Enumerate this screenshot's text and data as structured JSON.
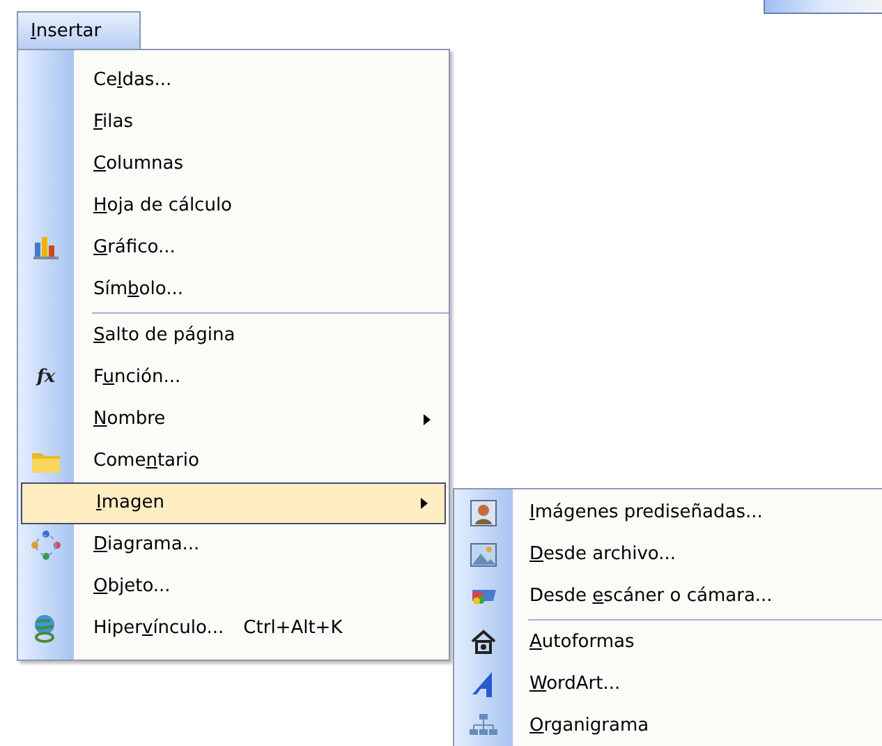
{
  "menu_bar": {
    "menu_title": {
      "key": "I",
      "after": "nsertar"
    },
    "open": true
  },
  "menu": {
    "items": [
      {
        "kind": "item",
        "label": {
          "before": "Ce",
          "key": "l",
          "after": "das..."
        },
        "selected": false
      },
      {
        "kind": "item",
        "label": {
          "key": "F",
          "after": "ilas"
        },
        "selected": false
      },
      {
        "kind": "item",
        "label": {
          "key": "C",
          "after": "olumnas"
        },
        "selected": false
      },
      {
        "kind": "item",
        "label": {
          "key": "H",
          "after": "oja de cálculo"
        },
        "selected": false
      },
      {
        "kind": "item",
        "label": {
          "key": "G",
          "after": "ráfico..."
        },
        "selected": false
      },
      {
        "kind": "item",
        "label": {
          "before": "Sím",
          "key": "b",
          "after": "olo..."
        },
        "selected": false
      },
      {
        "kind": "separator"
      },
      {
        "kind": "item",
        "label": {
          "key": "S",
          "after": "alto de página"
        },
        "selected": false
      },
      {
        "kind": "item",
        "label": {
          "before": "F",
          "key": "u",
          "after": "nción..."
        },
        "icon_glyph": "fx",
        "selected": false
      },
      {
        "kind": "item",
        "label": {
          "key": "N",
          "after": "ombre"
        },
        "selected": false,
        "has_submenu": true
      },
      {
        "kind": "item",
        "label": {
          "before": "Come",
          "key": "n",
          "after": "tario"
        },
        "selected": false
      },
      {
        "kind": "item",
        "label": {
          "key": "I",
          "after": "magen"
        },
        "selected": true,
        "has_submenu": true
      },
      {
        "kind": "item",
        "label": {
          "key": "D",
          "after": "iagrama..."
        },
        "selected": false
      },
      {
        "kind": "item",
        "label": {
          "key": "O",
          "after": "bjeto..."
        },
        "selected": false
      },
      {
        "kind": "item",
        "label": {
          "before": "Hiper",
          "key": "v",
          "after": "ínculo..."
        },
        "shortcut": "Ctrl+Alt+K",
        "selected": false
      }
    ]
  },
  "submenu": {
    "items": [
      {
        "kind": "item",
        "label": {
          "key": "I",
          "after": "mágenes prediseñadas..."
        },
        "selected": false
      },
      {
        "kind": "item",
        "label": {
          "key": "D",
          "after": "esde archivo..."
        },
        "selected": false
      },
      {
        "kind": "item",
        "label": {
          "before": "Desde ",
          "key": "e",
          "after": "scáner o cámara..."
        },
        "selected": false
      },
      {
        "kind": "separator"
      },
      {
        "kind": "item",
        "label": {
          "key": "A",
          "after": "utoformas"
        },
        "selected": false
      },
      {
        "kind": "item",
        "label": {
          "key": "W",
          "after": "ordArt..."
        },
        "selected": false
      },
      {
        "kind": "item",
        "label": {
          "key": "O",
          "after": "rganigrama"
        },
        "selected": false
      }
    ]
  }
}
